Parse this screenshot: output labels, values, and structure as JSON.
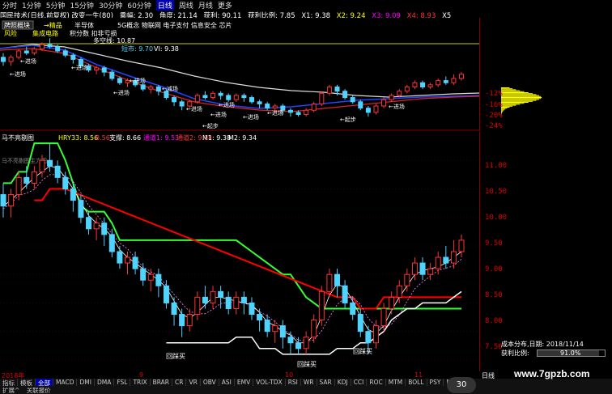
{
  "topbar": {
    "periods": [
      "分时",
      "1分钟",
      "5分钟",
      "15分钟",
      "30分钟",
      "60分钟",
      "日线",
      "周线",
      "月线",
      "更多"
    ],
    "selected": "日线"
  },
  "infobar": {
    "name": "国民技术(日线,前复权) 改变一生(80)",
    "zhenfu": "乘幅: 2.30",
    "jiaodu": "角度: 21.14",
    "huoli": "获利: 90.11",
    "huolibili": "获利比例: 7.85",
    "x1": "X1: 9.38",
    "x2": "X2: 9.24",
    "x3": "X3: 9.09",
    "x4": "X4: 8.93",
    "x5": "X5"
  },
  "panel1": {
    "tag1": "牌照概块",
    "tag2": "风险",
    "tag3": "→精品",
    "tag4": "半导体",
    "tag5": "5G概念 物联网 电子支付 信息安全 芯片",
    "tag6": "集成电路",
    "tag7": "积分数 扣非亏损",
    "tag8": "多空线: 10.87",
    "tag9": "短市: 9.70",
    "tag10": "VI: 9.38",
    "labels": [
      "进场",
      "进场",
      "进场",
      "进场",
      "进场",
      "减场",
      "进场",
      "进场",
      "进场",
      "进场",
      "进场",
      "起步",
      "起步",
      "进场"
    ],
    "pct": [
      "-12%",
      "-16%",
      "-20%",
      "-24%"
    ]
  },
  "panel2": {
    "title": "马不亮剔图",
    "hry": "HRY33: 8.56",
    "v2": "8.56",
    "zhicheng": "支撑: 8.66",
    "tongdao1": "通道1: 9.53",
    "tongdao2": "通道2: 9.18",
    "m1": "M1: 9.38",
    "m2": "M2: 9.34",
    "ylabels": [
      "11.00",
      "10.50",
      "10.00",
      "9.50",
      "9.00",
      "8.50",
      "8.00",
      "7.50"
    ],
    "buy_labels": [
      "回踩买",
      "回踩买",
      "回踩买"
    ],
    "tag_small": "马不亮剔图主力图"
  },
  "rightinfo": {
    "cost": "成本分布,日期: 2018/11/14",
    "ratio_label": "获利比例:",
    "ratio_value": "91.0%"
  },
  "bottombar": {
    "year": "2018年",
    "m1": "9",
    "m2": "10",
    "m3": "11",
    "right": "日线"
  },
  "tabs": [
    "指标",
    "模板",
    "全部",
    "MACD",
    "DMI",
    "DMA",
    "FSL",
    "TRIX",
    "BRAR",
    "CR",
    "VR",
    "OBV",
    "ASI",
    "EMV",
    "VOL-TDX",
    "RSI",
    "WR",
    "SAR",
    "KDJ",
    "CCI",
    "ROC",
    "MTM",
    "BOLL",
    "PSY",
    "MCST"
  ],
  "footer": [
    "扩展^",
    "关联报价"
  ],
  "badge": "30",
  "watermark": "www.7gpzb.com",
  "colors": {
    "up": "#ff3333",
    "down": "#4fd3ff",
    "green": "#33ff33",
    "white": "#ffffff",
    "red": "#ff0000"
  },
  "chart_data": {
    "type": "candlestick",
    "y_range": [
      7.3,
      11.5
    ],
    "candles": [
      [
        10.4,
        10.2,
        10.6,
        10.0
      ],
      [
        10.2,
        10.4,
        10.5,
        10.0
      ],
      [
        10.4,
        10.7,
        10.8,
        10.3
      ],
      [
        10.7,
        10.6,
        10.9,
        10.5
      ],
      [
        10.6,
        10.8,
        10.9,
        10.5
      ],
      [
        10.8,
        11.0,
        11.1,
        10.7
      ],
      [
        11.0,
        10.9,
        11.3,
        10.8
      ],
      [
        10.9,
        10.7,
        11.0,
        10.6
      ],
      [
        10.7,
        10.5,
        10.8,
        10.4
      ],
      [
        10.5,
        10.3,
        10.6,
        10.1
      ],
      [
        10.3,
        10.0,
        10.4,
        9.9
      ],
      [
        10.0,
        9.8,
        10.1,
        9.7
      ],
      [
        9.8,
        9.9,
        10.0,
        9.6
      ],
      [
        9.9,
        9.7,
        10.0,
        9.5
      ],
      [
        9.7,
        9.4,
        9.8,
        9.3
      ],
      [
        9.4,
        9.2,
        9.5,
        9.1
      ],
      [
        9.2,
        9.3,
        9.4,
        9.0
      ],
      [
        9.3,
        9.1,
        9.4,
        9.0
      ],
      [
        9.1,
        8.9,
        9.2,
        8.8
      ],
      [
        8.9,
        9.0,
        9.1,
        8.7
      ],
      [
        9.0,
        8.8,
        9.1,
        8.6
      ],
      [
        8.8,
        8.5,
        8.9,
        8.4
      ],
      [
        8.5,
        8.3,
        8.6,
        8.1
      ],
      [
        8.3,
        8.1,
        8.4,
        7.9
      ],
      [
        8.1,
        8.3,
        8.4,
        8.0
      ],
      [
        8.3,
        8.6,
        8.7,
        8.2
      ],
      [
        8.6,
        8.5,
        8.8,
        8.4
      ],
      [
        8.5,
        8.7,
        8.8,
        8.4
      ],
      [
        8.7,
        8.6,
        8.8,
        8.4
      ],
      [
        8.6,
        8.4,
        8.7,
        8.3
      ],
      [
        8.4,
        8.6,
        8.7,
        8.3
      ],
      [
        8.6,
        8.5,
        8.7,
        8.3
      ],
      [
        8.5,
        8.3,
        8.6,
        8.2
      ],
      [
        8.3,
        8.2,
        8.4,
        8.0
      ],
      [
        8.2,
        8.0,
        8.3,
        7.9
      ],
      [
        8.0,
        8.1,
        8.2,
        7.8
      ],
      [
        8.1,
        7.9,
        8.2,
        7.7
      ],
      [
        7.9,
        7.8,
        8.0,
        7.6
      ],
      [
        7.8,
        7.7,
        7.9,
        7.6
      ],
      [
        7.7,
        7.9,
        8.0,
        7.6
      ],
      [
        7.9,
        8.2,
        8.3,
        7.8
      ],
      [
        8.2,
        8.7,
        8.8,
        8.1
      ],
      [
        8.7,
        9.0,
        9.1,
        8.6
      ],
      [
        9.0,
        8.8,
        9.1,
        8.6
      ],
      [
        8.8,
        8.5,
        8.9,
        8.4
      ],
      [
        8.5,
        8.3,
        8.6,
        8.2
      ],
      [
        8.3,
        8.0,
        8.4,
        7.9
      ],
      [
        8.0,
        7.8,
        8.1,
        7.6
      ],
      [
        7.8,
        8.1,
        8.2,
        7.7
      ],
      [
        8.1,
        8.4,
        8.5,
        8.0
      ],
      [
        8.4,
        8.6,
        8.7,
        8.3
      ],
      [
        8.6,
        8.8,
        8.9,
        8.5
      ],
      [
        8.8,
        9.0,
        9.1,
        8.7
      ],
      [
        9.0,
        9.2,
        9.3,
        8.9
      ],
      [
        9.2,
        9.0,
        9.3,
        8.9
      ],
      [
        9.0,
        9.1,
        9.2,
        8.9
      ],
      [
        9.1,
        9.3,
        9.4,
        9.0
      ],
      [
        9.3,
        9.2,
        9.5,
        9.1
      ],
      [
        9.2,
        9.4,
        9.6,
        9.1
      ],
      [
        9.4,
        9.6,
        9.7,
        9.3
      ]
    ],
    "support_green": [
      10.6,
      10.6,
      10.8,
      10.8,
      11.3,
      11.3,
      11.3,
      11.3,
      11.0,
      10.6,
      10.2,
      10.1,
      10.1,
      10.1,
      9.9,
      9.6,
      9.6,
      9.6,
      9.6,
      9.6,
      9.6,
      9.6,
      9.6,
      9.6,
      9.6,
      9.6,
      9.6,
      9.6,
      9.6,
      9.6,
      9.6,
      9.5,
      9.4,
      9.3,
      9.2,
      9.1,
      9.0,
      9.0,
      8.8,
      8.6,
      8.5,
      8.4,
      8.4,
      8.4,
      8.4,
      8.4,
      8.4,
      8.4,
      8.4,
      8.4,
      8.4,
      8.4,
      8.4,
      8.4,
      8.4,
      8.4,
      8.4,
      8.4,
      8.4,
      8.4
    ],
    "support_red": [
      null,
      null,
      null,
      null,
      10.3,
      10.3,
      10.5,
      10.5,
      10.5,
      null,
      null,
      null,
      null,
      null,
      null,
      null,
      null,
      null,
      null,
      null,
      null,
      null,
      null,
      null,
      null,
      null,
      null,
      null,
      null,
      null,
      null,
      null,
      null,
      null,
      null,
      null,
      null,
      null,
      null,
      null,
      null,
      null,
      null,
      8.6,
      8.6,
      8.6,
      8.4,
      8.4,
      8.4,
      8.6,
      8.6,
      8.6,
      8.6,
      8.6,
      8.6,
      8.6,
      8.6,
      8.6,
      8.6,
      8.6
    ],
    "support_white": [
      null,
      null,
      null,
      null,
      null,
      null,
      null,
      null,
      null,
      null,
      null,
      null,
      null,
      null,
      null,
      null,
      null,
      null,
      null,
      null,
      null,
      7.8,
      7.8,
      7.8,
      7.8,
      7.8,
      7.8,
      7.8,
      7.8,
      7.8,
      7.9,
      7.9,
      7.9,
      7.7,
      7.7,
      7.7,
      7.6,
      7.6,
      7.6,
      7.6,
      7.6,
      7.6,
      7.6,
      7.7,
      7.7,
      7.7,
      7.8,
      7.8,
      7.9,
      8.0,
      8.2,
      8.3,
      8.4,
      8.4,
      8.5,
      8.5,
      8.5,
      8.5,
      8.6,
      8.7
    ]
  }
}
